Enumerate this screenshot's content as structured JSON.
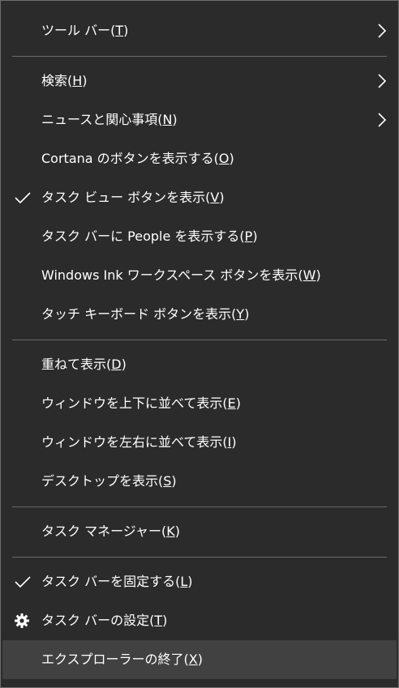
{
  "menu": {
    "items": [
      {
        "label": "ツール バー(",
        "key": "T",
        "suffix": ")"
      },
      {
        "label": "検索(",
        "key": "H",
        "suffix": ")"
      },
      {
        "label": "ニュースと関心事項(",
        "key": "N",
        "suffix": ")"
      },
      {
        "label": "Cortana のボタンを表示する(",
        "key": "O",
        "suffix": ")"
      },
      {
        "label": "タスク ビュー ボタンを表示(",
        "key": "V",
        "suffix": ")"
      },
      {
        "label": "タスク バーに People を表示する(",
        "key": "P",
        "suffix": ")"
      },
      {
        "label": "Windows Ink ワークスペース ボタンを表示(",
        "key": "W",
        "suffix": ")"
      },
      {
        "label": "タッチ キーボード ボタンを表示(",
        "key": "Y",
        "suffix": ")"
      },
      {
        "label": "重ねて表示(",
        "key": "D",
        "suffix": ")"
      },
      {
        "label": "ウィンドウを上下に並べて表示(",
        "key": "E",
        "suffix": ")"
      },
      {
        "label": "ウィンドウを左右に並べて表示(",
        "key": "I",
        "suffix": ")"
      },
      {
        "label": "デスクトップを表示(",
        "key": "S",
        "suffix": ")"
      },
      {
        "label": "タスク マネージャー(",
        "key": "K",
        "suffix": ")"
      },
      {
        "label": "タスク バーを固定する(",
        "key": "L",
        "suffix": ")"
      },
      {
        "label": "タスク バーの設定(",
        "key": "T",
        "suffix": ")"
      },
      {
        "label": "エクスプローラーの終了(",
        "key": "X",
        "suffix": ")"
      }
    ]
  },
  "icons": {
    "submenu": "chevron-right-icon",
    "checked": "checkmark-icon",
    "settings": "gear-icon"
  },
  "colors": {
    "background": "#2b2b2b",
    "border": "#6e6e6e",
    "text": "#ffffff",
    "separator": "#6a6a6a",
    "highlight": "#414141"
  }
}
